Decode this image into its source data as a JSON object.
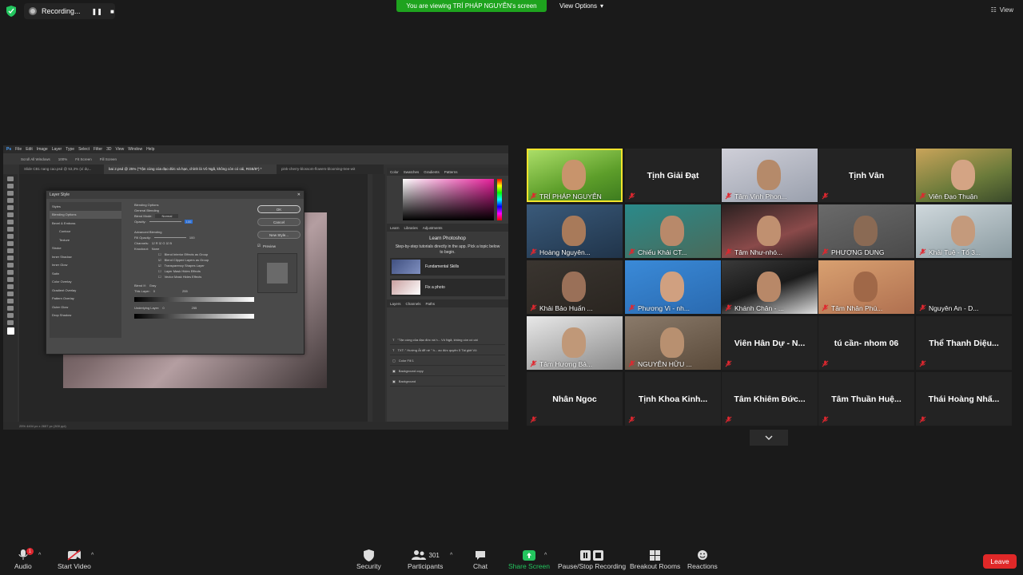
{
  "topbar": {
    "recording_label": "Recording...",
    "viewing_label": "You are viewing TRÍ PHÁP NGUYỄN's screen",
    "view_options_label": "View Options",
    "view_label": "View"
  },
  "shared_screen": {
    "menu": [
      "File",
      "Edit",
      "Image",
      "Layer",
      "Type",
      "Select",
      "Filter",
      "3D",
      "View",
      "Window",
      "Help"
    ],
    "options": [
      "Scroll All Windows",
      "100%",
      "Fit Screen",
      "Fill Screen"
    ],
    "tabs": [
      "Slide CB1 nang cao.psd @ 53,3% (xí dụ...",
      "bai 2.psd @ 25% (\"Tận cùng của đạo đức và hạn, chính là  Vô Ngã, không còn có cái, RGB/8*) *",
      "pink-cherry-blossom-flowers-blooming-tree-wit"
    ],
    "dialog": {
      "title": "Layer Style",
      "styles": [
        "Styles",
        "Blending Options",
        "Bevel & Emboss",
        "Contour",
        "Texture",
        "Stroke",
        "Inner Shadow",
        "Inner Glow",
        "Satin",
        "Color Overlay",
        "Gradient Overlay",
        "Pattern Overlay",
        "Outer Glow",
        "Drop Shadow"
      ],
      "section_title": "Blending Options",
      "general": "General Blending",
      "blend_mode_label": "Blend Mode:",
      "blend_mode_value": "Normal",
      "opacity_label": "Opacity:",
      "opacity_value": "100",
      "advanced": "Advanced Blending",
      "fill_opacity_label": "Fill Opacity:",
      "fill_opacity_value": "100",
      "channels_label": "Channels:",
      "knockout_label": "Knockout:",
      "knockout_value": "None",
      "options": [
        "Blend Interior Effects as Group",
        "Blend Clipped Layers as Group",
        "Transparency Shapes Layer",
        "Layer Mask Hides Effects",
        "Vector Mask Hides Effects"
      ],
      "blend_if_label": "Blend If:",
      "blend_if_value": "Gray",
      "this_layer_label": "This Layer:",
      "underlying_label": "Underlying Layer:",
      "range_min": "0",
      "range_max": "255",
      "ok": "OK",
      "cancel": "Cancel",
      "new_style": "New Style...",
      "preview": "Preview"
    },
    "panel": {
      "color_tabs": [
        "Color",
        "Swatches",
        "Gradients",
        "Patterns"
      ],
      "learn_tabs": [
        "Learn",
        "Libraries",
        "Adjustments"
      ],
      "learn_title": "Learn Photoshop",
      "learn_sub": "Step-by-step tutorials directly in the app. Pick a topic below to begin.",
      "cards": [
        "Fundamental Skills",
        "Fix a photo"
      ],
      "layer_tabs": [
        "Layers",
        "Channels",
        "Paths"
      ],
      "layers": [
        "\"Tận cùng của đạo đức và h... Vô Ngã, không còn có cái",
        "TXT: \" Hướng Ất để nề \" h... ao đức quyên 5 Tài giới Vô",
        "Color Fill 1",
        "Background copy",
        "Background"
      ]
    },
    "status": "25%     4404 px x 2657 px (300 ppi)"
  },
  "participants": [
    {
      "name": "TRÍ PHÁP NGUYỄN",
      "video": true,
      "active": true
    },
    {
      "name": "Tịnh Giải Đạt",
      "video": false
    },
    {
      "name": "Tâm Vinh Phon...",
      "video": true
    },
    {
      "name": "Tịnh Vân",
      "video": false
    },
    {
      "name": "Viên Đạo Thuận",
      "video": true
    },
    {
      "name": "Hoàng Nguyên...",
      "video": true
    },
    {
      "name": "Chiếu Khải CT...",
      "video": true
    },
    {
      "name": "Tâm Như-nhó...",
      "video": true
    },
    {
      "name": "PHƯỢNG DUNG",
      "video": true
    },
    {
      "name": "Khải Tuệ - Tổ 3...",
      "video": true
    },
    {
      "name": "Khải Bảo Huấn ...",
      "video": true
    },
    {
      "name": "Phương Vi - nh...",
      "video": true
    },
    {
      "name": "Khánh Chân - ...",
      "video": true
    },
    {
      "name": "Tâm Nhân Phú...",
      "video": true
    },
    {
      "name": "Nguyên An - D...",
      "video": false,
      "small": true
    },
    {
      "name": "Tâm Hương Bả...",
      "video": true
    },
    {
      "name": "NGUYỄN HỮU ...",
      "video": true
    },
    {
      "name": "Viên Hân Dự - N...",
      "video": false
    },
    {
      "name": "tú cần- nhom 06",
      "video": false
    },
    {
      "name": "Thể Thanh Diệu...",
      "video": false
    },
    {
      "name": "Nhân Ngoc",
      "video": false
    },
    {
      "name": "Tịnh Khoa Kinh...",
      "video": false
    },
    {
      "name": "Tâm Khiêm Đức...",
      "video": false
    },
    {
      "name": "Tâm Thuần Huệ...",
      "video": false
    },
    {
      "name": "Thái Hoàng Nhấ...",
      "video": false
    }
  ],
  "toolbar": {
    "audio": "Audio",
    "start_video": "Start Video",
    "security": "Security",
    "participants": "Participants",
    "participants_count": "301",
    "chat": "Chat",
    "share_screen": "Share Screen",
    "recording": "Pause/Stop Recording",
    "breakout": "Breakout Rooms",
    "reactions": "Reactions",
    "leave": "Leave",
    "audio_badge": "1"
  },
  "colors": {
    "viewing_banner": "#1ea31e",
    "active_speaker": "#f2e52b",
    "share_green": "#23c55e",
    "leave_red": "#e02828",
    "mic_off_red": "#e0272f"
  }
}
